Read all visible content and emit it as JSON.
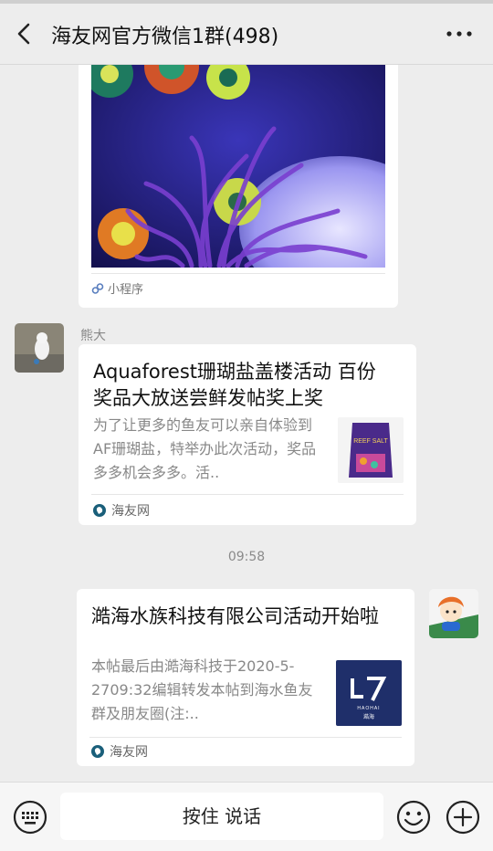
{
  "header": {
    "title": "海友网官方微信1群(498)",
    "back_icon": "chevron-left-icon",
    "more_icon": "more-dots-icon"
  },
  "messages": [
    {
      "type": "mini_program",
      "footer_label": "小程序",
      "footer_icon": "mini-program-icon"
    },
    {
      "type": "link_card",
      "sender": "熊大",
      "title": "Aquaforest珊瑚盐盖楼活动 百份奖品大放送尝鲜发帖奖上奖",
      "description": "为了让更多的鱼友可以亲自体验到AF珊瑚盐，特举办此次活动，奖品多多机会多多。活..",
      "thumb_text": "REEF SALT",
      "source": "海友网"
    },
    {
      "type": "timestamp",
      "time": "09:58"
    },
    {
      "type": "link_card",
      "sender": "self",
      "title": "澔海水族科技有限公司活动开始啦",
      "description": "本帖最后由澔海科技于2020-5-2709:32编辑转发本帖到海水鱼友群及朋友圈(注:..",
      "thumb_text": "HAOHAI",
      "thumb_sub": "澔海",
      "source": "海友网"
    }
  ],
  "input_bar": {
    "voice_label": "按住 说话",
    "keyboard_icon": "keyboard-icon",
    "emoji_icon": "emoji-icon",
    "plus_icon": "plus-icon"
  },
  "colors": {
    "background": "#ededed",
    "card": "#ffffff",
    "muted_text": "#888888",
    "source_icon": "#1a5f7a"
  }
}
